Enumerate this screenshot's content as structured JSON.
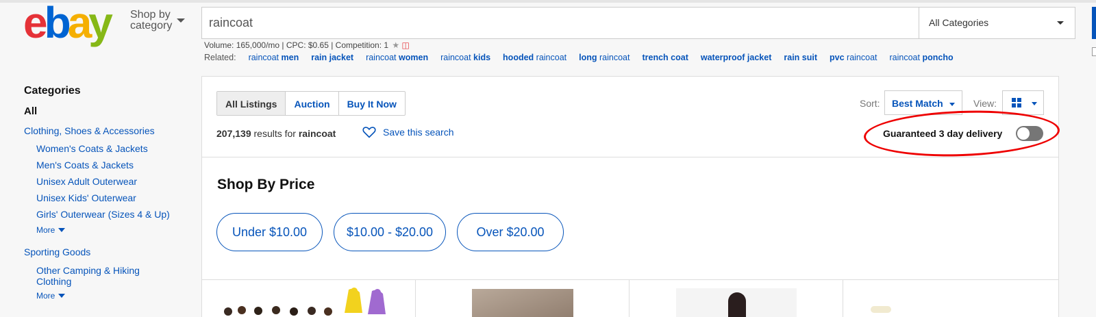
{
  "header": {
    "logo": "ebay",
    "shop_by_category": "Shop by category",
    "search_value": "raincoat",
    "category_select": "All Categories"
  },
  "keyword_stats": {
    "volume": "Volume: 165,000/mo | CPC: $0.65 | Competition: 1"
  },
  "related": {
    "label": "Related:",
    "items": [
      {
        "plain": "raincoat ",
        "bold": "men"
      },
      {
        "plain": "",
        "bold": "rain jacket"
      },
      {
        "plain": "raincoat ",
        "bold": "women"
      },
      {
        "plain": "raincoat ",
        "bold": "kids"
      },
      {
        "plain": " raincoat",
        "bold": "hooded",
        "bold_first": true
      },
      {
        "plain": " raincoat",
        "bold": "long",
        "bold_first": true
      },
      {
        "plain": "",
        "bold": "trench coat"
      },
      {
        "plain": "",
        "bold": "waterproof jacket"
      },
      {
        "plain": "",
        "bold": "rain suit"
      },
      {
        "plain": " raincoat",
        "bold": "pvc",
        "bold_first": true
      },
      {
        "plain": "raincoat ",
        "bold": "poncho"
      }
    ]
  },
  "sidebar": {
    "title": "Categories",
    "all": "All",
    "cat1": "Clothing, Shoes & Accessories",
    "sub1": [
      "Women's Coats & Jackets",
      "Men's Coats & Jackets",
      "Unisex Adult Outerwear",
      "Unisex Kids' Outerwear",
      "Girls' Outerwear (Sizes 4 & Up)"
    ],
    "more": "More",
    "cat2": "Sporting Goods",
    "sub2": [
      "Other Camping & Hiking Clothing"
    ]
  },
  "tabs": [
    "All Listings",
    "Auction",
    "Buy It Now"
  ],
  "results": {
    "count": "207,139",
    "text": " results for ",
    "query": "raincoat",
    "save_search": "Save this search"
  },
  "sort": {
    "label": "Sort:",
    "value": "Best Match",
    "view_label": "View:"
  },
  "guaranteed": {
    "label": "Guaranteed 3 day delivery",
    "enabled": false
  },
  "shop_by_price": {
    "title": "Shop By Price",
    "buttons": [
      "Under $10.00",
      "$10.00 - $20.00",
      "Over $20.00"
    ]
  },
  "colors": {
    "link": "#0654ba",
    "annotation": "#e00000"
  }
}
